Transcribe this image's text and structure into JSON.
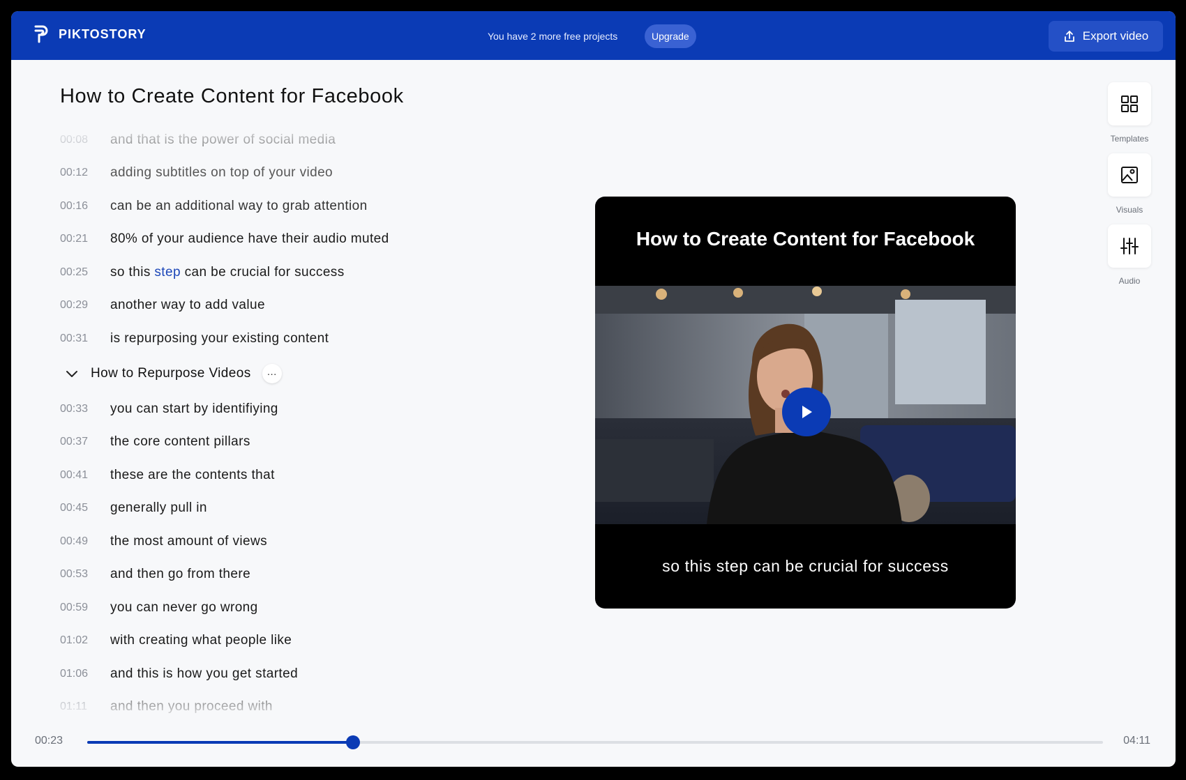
{
  "app": {
    "brand": "PIKTOSTORY"
  },
  "header": {
    "free_info": "You have 2 more free projects",
    "upgrade_label": "Upgrade",
    "export_label": "Export video"
  },
  "project": {
    "title": "How to Create Content for Facebook"
  },
  "transcript": {
    "lines_before": [
      {
        "time": "00:08",
        "text": "and that is the power of social media"
      },
      {
        "time": "00:12",
        "text": "adding subtitles on top of your video"
      },
      {
        "time": "00:16",
        "text": "can be an additional way to grab attention"
      },
      {
        "time": "00:21",
        "text": "80% of your audience have their audio muted"
      }
    ],
    "active_line": {
      "time": "00:25",
      "pre": "so this ",
      "highlight": "step",
      "post": " can be crucial for success"
    },
    "lines_after": [
      {
        "time": "00:29",
        "text": "another way to add value"
      },
      {
        "time": "00:31",
        "text": "is repurposing your existing content"
      }
    ],
    "section": {
      "title": "How to Repurpose Videos",
      "more_label": "···"
    },
    "section_lines": [
      {
        "time": "00:33",
        "text": "you can start by identifiying"
      },
      {
        "time": "00:37",
        "text": "the core content pillars"
      },
      {
        "time": "00:41",
        "text": "these are the contents that"
      },
      {
        "time": "00:45",
        "text": "generally pull in"
      },
      {
        "time": "00:49",
        "text": "the most amount of views"
      },
      {
        "time": "00:53",
        "text": "and then go from there"
      },
      {
        "time": "00:59",
        "text": "you can never go wrong"
      },
      {
        "time": "01:02",
        "text": "with creating what people like"
      },
      {
        "time": "01:06",
        "text": "and this is how you get started"
      },
      {
        "time": "01:11",
        "text": "and then you proceed with"
      }
    ]
  },
  "preview": {
    "title": "How to Create Content for Facebook",
    "caption": "so this step can be crucial for success"
  },
  "tools": [
    {
      "label": "Templates",
      "icon": "grid-icon"
    },
    {
      "label": "Visuals",
      "icon": "image-icon"
    },
    {
      "label": "Audio",
      "icon": "sliders-icon"
    }
  ],
  "player": {
    "current_time": "00:23",
    "total_time": "04:11",
    "progress": 0.262
  },
  "colors": {
    "brand": "#0b3bb5",
    "highlight": "#1d47b8"
  }
}
